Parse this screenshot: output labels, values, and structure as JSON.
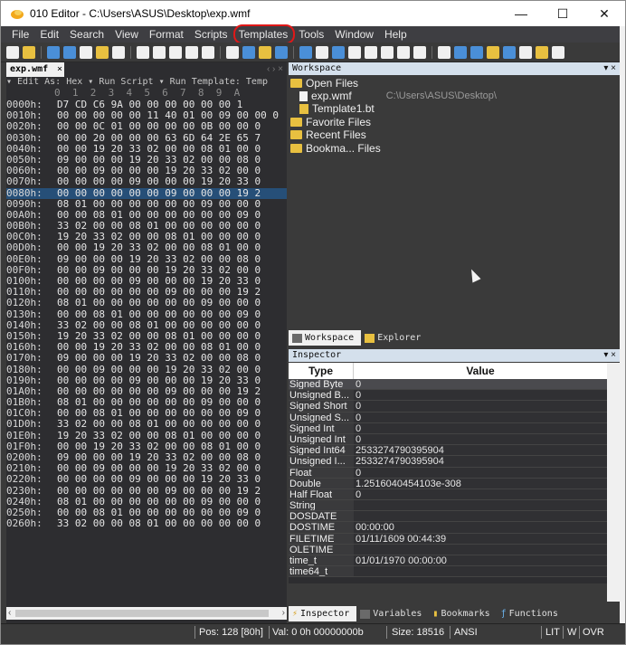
{
  "window": {
    "title": "010 Editor - C:\\Users\\ASUS\\Desktop\\exp.wmf",
    "minimize": "—",
    "maximize": "☐",
    "close": "✕"
  },
  "menu": [
    "File",
    "Edit",
    "Search",
    "View",
    "Format",
    "Scripts",
    "Templates",
    "Tools",
    "Window",
    "Help"
  ],
  "editor": {
    "tab_label": "exp.wmf",
    "tab_close": "×",
    "tab_arrows": "‹ › ×",
    "sub_toolbar": "▾ Edit As: Hex ▾  Run Script ▾  Run Template: Temp",
    "column_header": "        0  1  2  3  4  5  6  7  8  9  A",
    "rows": [
      {
        "addr": "0000h:",
        "bytes": "D7 CD C6 9A 00 00 00 00 00 00 1"
      },
      {
        "addr": "0010h:",
        "bytes": "00 00 00 00 00 11 40 01 00 09 00 00 0"
      },
      {
        "addr": "0020h:",
        "bytes": "00 00 0C 01 00 00 00 00 0B 00 00 0"
      },
      {
        "addr": "0030h:",
        "bytes": "00 00 20 00 00 00 63 6D 64 2E 65 7"
      },
      {
        "addr": "0040h:",
        "bytes": "00 00 19 20 33 02 00 00 08 01 00 0"
      },
      {
        "addr": "0050h:",
        "bytes": "09 00 00 00 19 20 33 02 00 00 08 0"
      },
      {
        "addr": "0060h:",
        "bytes": "00 00 09 00 00 00 19 20 33 02 00 0"
      },
      {
        "addr": "0070h:",
        "bytes": "00 00 00 00 09 00 00 00 19 20 33 0"
      },
      {
        "addr": "0080h:",
        "bytes": "00 00 00 00 00 00 09 00 00 00 19 2"
      },
      {
        "addr": "0090h:",
        "bytes": "08 01 00 00 00 00 00 00 09 00 00 0"
      },
      {
        "addr": "00A0h:",
        "bytes": "00 00 08 01 00 00 00 00 00 00 09 0"
      },
      {
        "addr": "00B0h:",
        "bytes": "33 02 00 00 08 01 00 00 00 00 00 0"
      },
      {
        "addr": "00C0h:",
        "bytes": "19 20 33 02 00 00 08 01 00 00 00 0"
      },
      {
        "addr": "00D0h:",
        "bytes": "00 00 19 20 33 02 00 00 08 01 00 0"
      },
      {
        "addr": "00E0h:",
        "bytes": "09 00 00 00 19 20 33 02 00 00 08 0"
      },
      {
        "addr": "00F0h:",
        "bytes": "00 00 09 00 00 00 19 20 33 02 00 0"
      },
      {
        "addr": "0100h:",
        "bytes": "00 00 00 00 09 00 00 00 19 20 33 0"
      },
      {
        "addr": "0110h:",
        "bytes": "00 00 00 00 00 00 09 00 00 00 19 2"
      },
      {
        "addr": "0120h:",
        "bytes": "08 01 00 00 00 00 00 00 09 00 00 0"
      },
      {
        "addr": "0130h:",
        "bytes": "00 00 08 01 00 00 00 00 00 00 09 0"
      },
      {
        "addr": "0140h:",
        "bytes": "33 02 00 00 08 01 00 00 00 00 00 0"
      },
      {
        "addr": "0150h:",
        "bytes": "19 20 33 02 00 00 08 01 00 00 00 0"
      },
      {
        "addr": "0160h:",
        "bytes": "00 00 19 20 33 02 00 00 08 01 00 0"
      },
      {
        "addr": "0170h:",
        "bytes": "09 00 00 00 19 20 33 02 00 00 08 0"
      },
      {
        "addr": "0180h:",
        "bytes": "00 00 09 00 00 00 19 20 33 02 00 0"
      },
      {
        "addr": "0190h:",
        "bytes": "00 00 00 00 09 00 00 00 19 20 33 0"
      },
      {
        "addr": "01A0h:",
        "bytes": "00 00 00 00 00 00 09 00 00 00 19 2"
      },
      {
        "addr": "01B0h:",
        "bytes": "08 01 00 00 00 00 00 00 09 00 00 0"
      },
      {
        "addr": "01C0h:",
        "bytes": "00 00 08 01 00 00 00 00 00 00 09 0"
      },
      {
        "addr": "01D0h:",
        "bytes": "33 02 00 00 08 01 00 00 00 00 00 0"
      },
      {
        "addr": "01E0h:",
        "bytes": "19 20 33 02 00 00 08 01 00 00 00 0"
      },
      {
        "addr": "01F0h:",
        "bytes": "00 00 19 20 33 02 00 00 08 01 00 0"
      },
      {
        "addr": "0200h:",
        "bytes": "09 00 00 00 19 20 33 02 00 00 08 0"
      },
      {
        "addr": "0210h:",
        "bytes": "00 00 09 00 00 00 19 20 33 02 00 0"
      },
      {
        "addr": "0220h:",
        "bytes": "00 00 00 00 09 00 00 00 19 20 33 0"
      },
      {
        "addr": "0230h:",
        "bytes": "00 00 00 00 00 00 09 00 00 00 19 2"
      },
      {
        "addr": "0240h:",
        "bytes": "08 01 00 00 00 00 00 00 09 00 00 0"
      },
      {
        "addr": "0250h:",
        "bytes": "00 00 08 01 00 00 00 00 00 00 09 0"
      },
      {
        "addr": "0260h:",
        "bytes": "33 02 00 00 08 01 00 00 00 00 00 0"
      }
    ],
    "selected_row": 8
  },
  "workspace": {
    "header": "Workspace",
    "header_ctl": "▾ ×",
    "open_files": "Open Files",
    "file1": "exp.wmf",
    "file1_path": "C:\\Users\\ASUS\\Desktop\\",
    "file2": "Template1.bt",
    "favorites": "Favorite Files",
    "recent": "Recent Files",
    "bookmarked": "Bookma... Files",
    "tab_workspace": "Workspace",
    "tab_explorer": "Explorer"
  },
  "inspector": {
    "header": "Inspector",
    "header_ctl": "▾ ×",
    "col_type": "Type",
    "col_value": "Value",
    "rows": [
      {
        "type": "Signed Byte",
        "value": "0"
      },
      {
        "type": "Unsigned B...",
        "value": "0"
      },
      {
        "type": "Signed Short",
        "value": "0"
      },
      {
        "type": "Unsigned S...",
        "value": "0"
      },
      {
        "type": "Signed Int",
        "value": "0"
      },
      {
        "type": "Unsigned Int",
        "value": "0"
      },
      {
        "type": "Signed Int64",
        "value": "2533274790395904"
      },
      {
        "type": "Unsigned I...",
        "value": "2533274790395904"
      },
      {
        "type": "Float",
        "value": "0"
      },
      {
        "type": "Double",
        "value": "1.2516040454103e-308"
      },
      {
        "type": "Half Float",
        "value": "0"
      },
      {
        "type": "String",
        "value": ""
      },
      {
        "type": "DOSDATE",
        "value": ""
      },
      {
        "type": "DOSTIME",
        "value": "00:00:00"
      },
      {
        "type": "FILETIME",
        "value": "01/11/1609 00:44:39"
      },
      {
        "type": "OLETIME",
        "value": ""
      },
      {
        "type": "time_t",
        "value": "01/01/1970 00:00:00"
      },
      {
        "type": "time64_t",
        "value": ""
      }
    ],
    "tab_inspector": "Inspector",
    "tab_variables": "Variables",
    "tab_bookmarks": "Bookmarks",
    "tab_functions": "Functions"
  },
  "status": {
    "pos": "Pos: 128 [80h]",
    "val": "Val: 0 0h 00000000b",
    "size": "Size: 18516",
    "encoding": "ANSI",
    "lit": "LIT",
    "w": "W",
    "ovr": "OVR"
  },
  "colors": {
    "accent_circle": "#e01818",
    "selection": "#264f78"
  }
}
